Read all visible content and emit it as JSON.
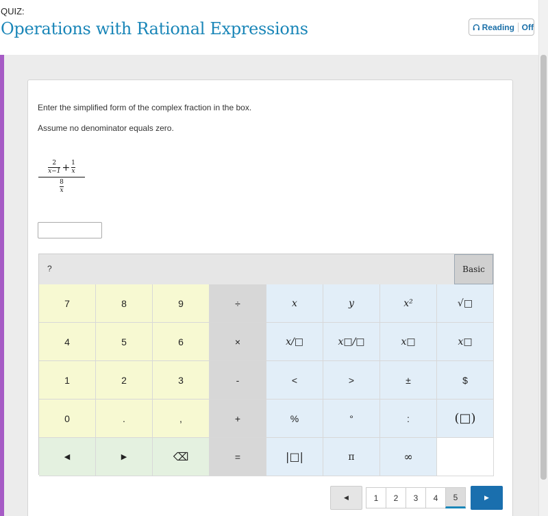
{
  "header": {
    "quiz_label": "QUIZ:",
    "title": "Operations with Rational Expressions",
    "reading_label": "Reading",
    "reading_state": "Off"
  },
  "question": {
    "line1": "Enter the simplified form of the complex fraction in the box.",
    "line2": "Assume no denominator equals zero.",
    "expression": {
      "term1_num": "2",
      "term1_den": "x−1",
      "operator": "+",
      "term2_num": "1",
      "term2_den": "x",
      "main_den_num": "8",
      "main_den_den": "x"
    },
    "answer_value": ""
  },
  "keypad": {
    "help_label": "?",
    "mode_label": "Basic",
    "rows": [
      [
        "7",
        "8",
        "9",
        "÷",
        "x",
        "y",
        "x²",
        "√□"
      ],
      [
        "4",
        "5",
        "6",
        "×",
        "x/□",
        "x□/□",
        "x□",
        "x□"
      ],
      [
        "1",
        "2",
        "3",
        "-",
        "<",
        ">",
        "±",
        "$"
      ],
      [
        "0",
        ".",
        ",",
        "+",
        "%",
        "°",
        ":",
        "(□)"
      ],
      [
        "◀",
        "▶",
        "⌫",
        "=",
        "|□|",
        "π",
        "∞",
        ""
      ]
    ]
  },
  "pagination": {
    "prev": "◀",
    "next": "▶",
    "pages": [
      "1",
      "2",
      "3",
      "4",
      "5"
    ],
    "current": "5"
  },
  "colors": {
    "title_blue": "#1a86b8",
    "accent_purple": "#a65bc5",
    "numeric_keys": "#f7f9d2",
    "operator_keys": "#d7d7d7",
    "algebra_keys": "#e2eef8",
    "next_button": "#1a6fae"
  }
}
